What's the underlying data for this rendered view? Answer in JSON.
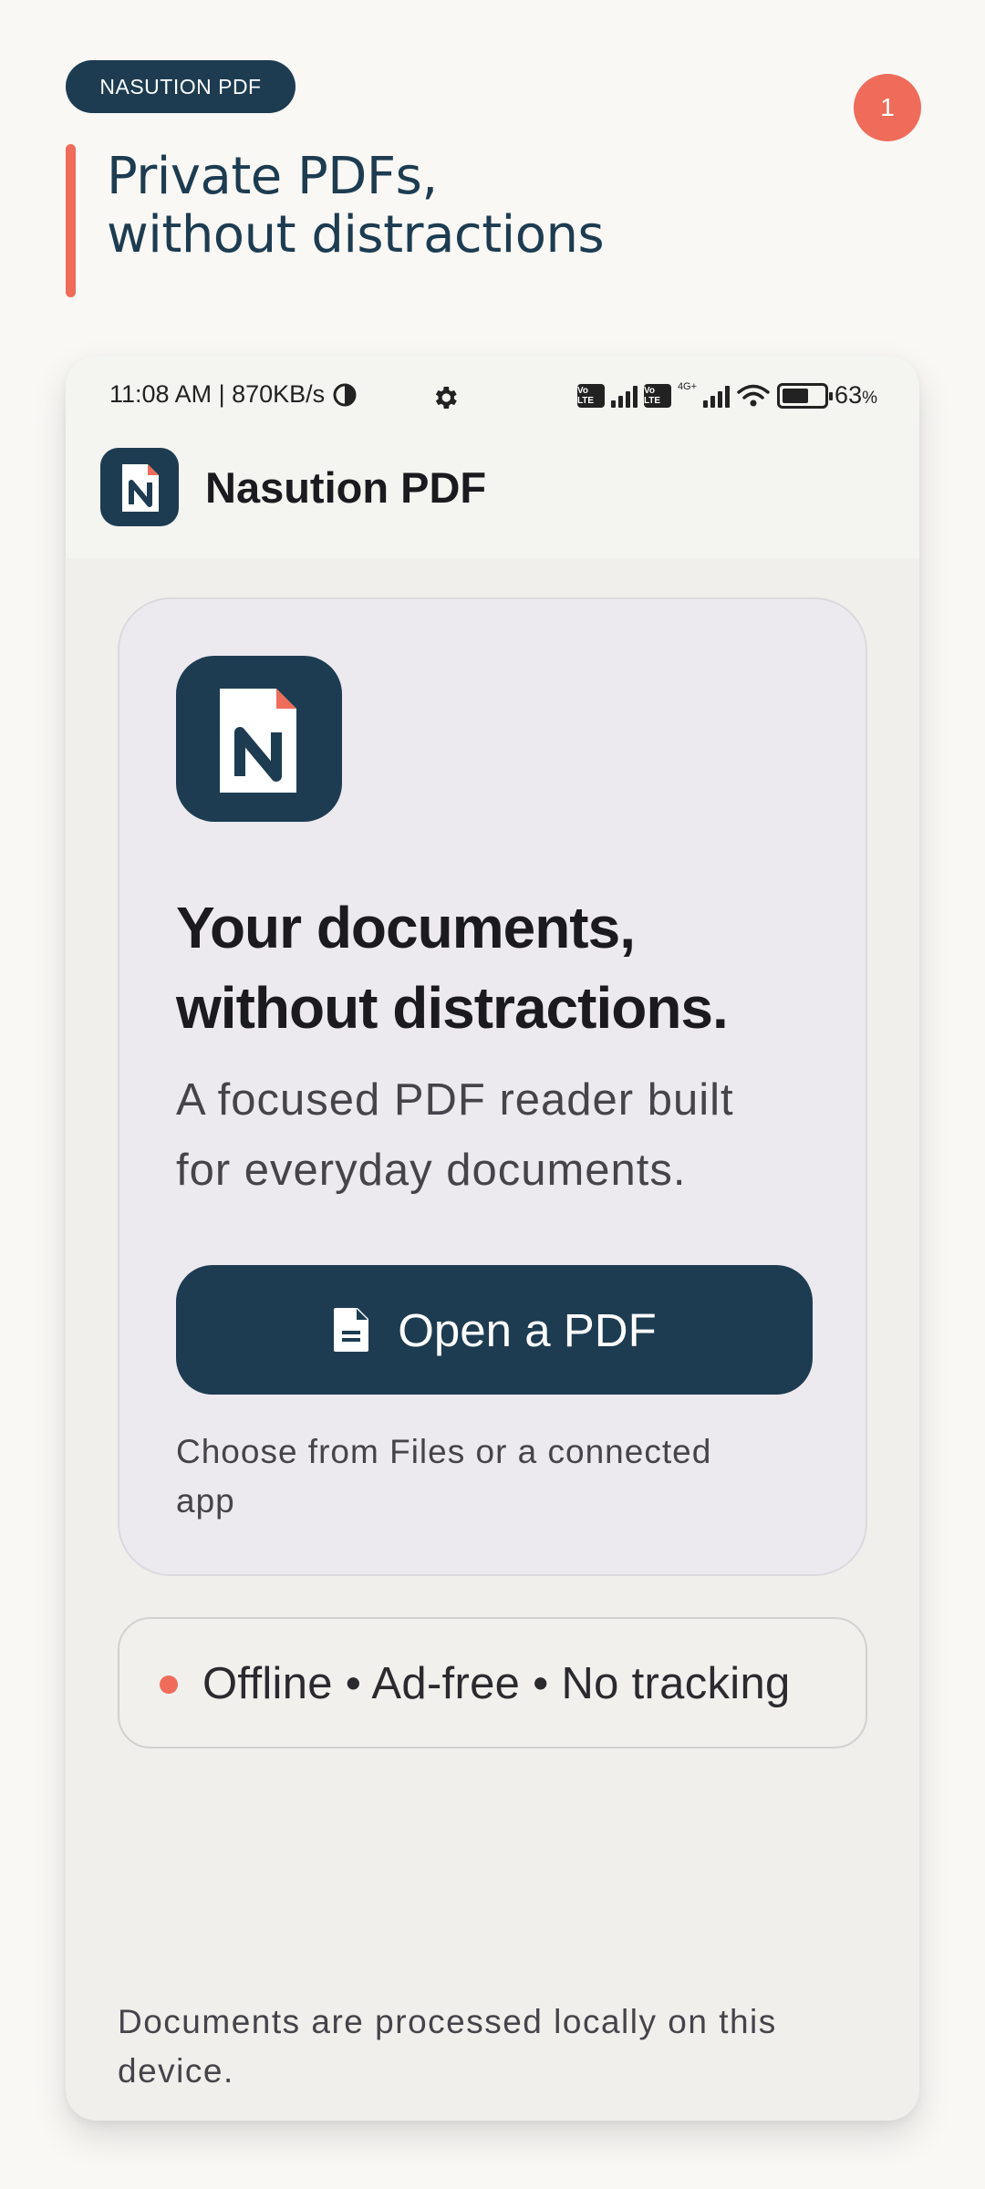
{
  "header": {
    "brand_label": "NASUTION PDF",
    "step_number": "1",
    "title_line1": "Private PDFs,",
    "title_line2": "without distractions"
  },
  "status_bar": {
    "left_text": "11:08 AM | 870KB/s",
    "network_label": "4G+",
    "volte_label": "Vo LTE",
    "battery_percent": "63",
    "battery_unit": "%"
  },
  "app_bar": {
    "title": "Nasution PDF",
    "logo_icon": "nasution-logo-icon"
  },
  "welcome_card": {
    "heading_line1": "Your documents,",
    "heading_line2": "without distractions.",
    "subtitle_line1": "A focused PDF reader built",
    "subtitle_line2": "for everyday documents.",
    "open_button_label": "Open a PDF",
    "open_button_icon": "document-icon",
    "hint_line1": "Choose from Files or a connected",
    "hint_line2": "app"
  },
  "features": {
    "text": "Offline • Ad-free • No tracking"
  },
  "footer": {
    "note_line1": "Documents are processed locally on this",
    "note_line2": "device."
  },
  "colors": {
    "navy": "#1d3c51",
    "coral": "#ef6c5a",
    "card_bg": "#ece9ef",
    "page_bg": "#f9f8f5"
  }
}
